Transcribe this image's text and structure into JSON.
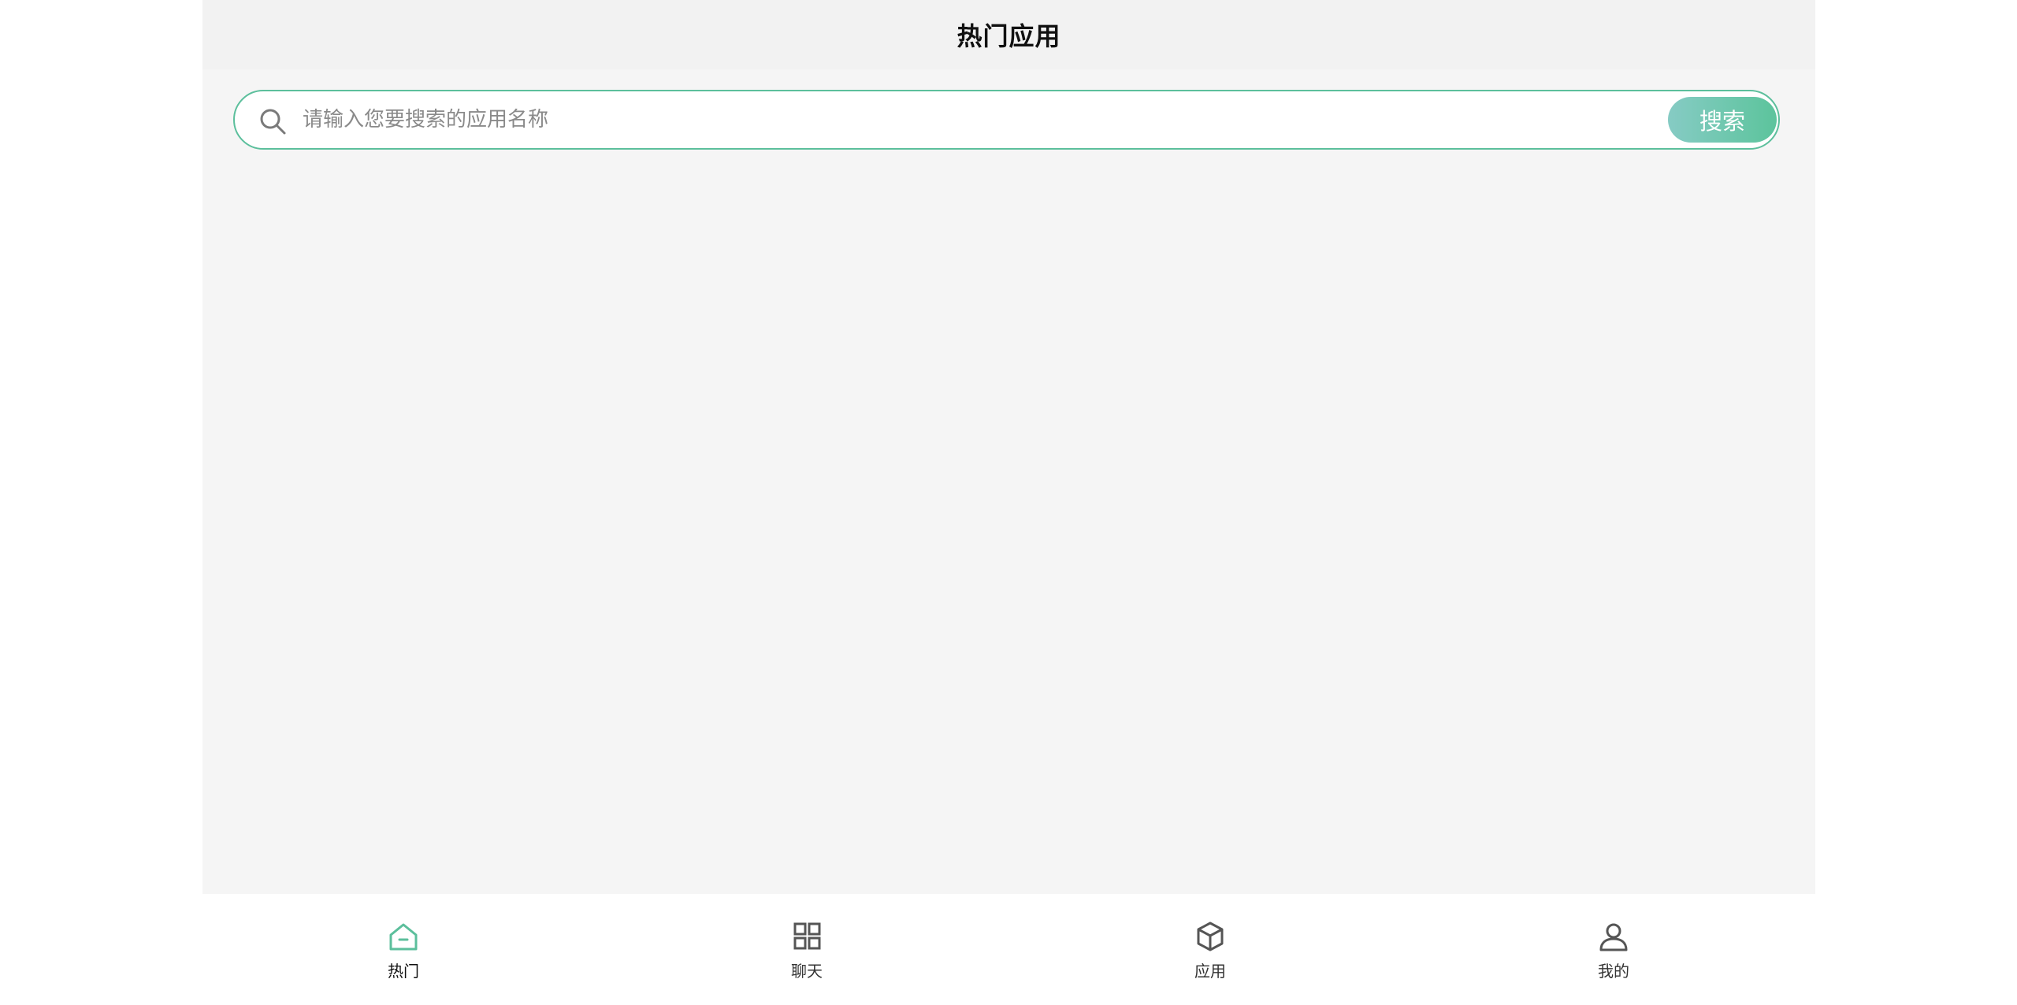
{
  "header": {
    "title": "热门应用"
  },
  "search": {
    "placeholder": "请输入您要搜索的应用名称",
    "value": "",
    "button_label": "搜索"
  },
  "tabbar": {
    "items": [
      {
        "label": "热门",
        "icon": "home-icon",
        "active": true
      },
      {
        "label": "聊天",
        "icon": "grid-icon",
        "active": false
      },
      {
        "label": "应用",
        "icon": "cube-icon",
        "active": false
      },
      {
        "label": "我的",
        "icon": "user-icon",
        "active": false
      }
    ]
  },
  "colors": {
    "accent": "#5cbf9c",
    "button_gradient_start": "#86cbc4",
    "button_gradient_end": "#5cc49c",
    "page_background": "#f5f5f5",
    "header_background": "#f2f2f2",
    "inactive_icon": "#555555"
  }
}
